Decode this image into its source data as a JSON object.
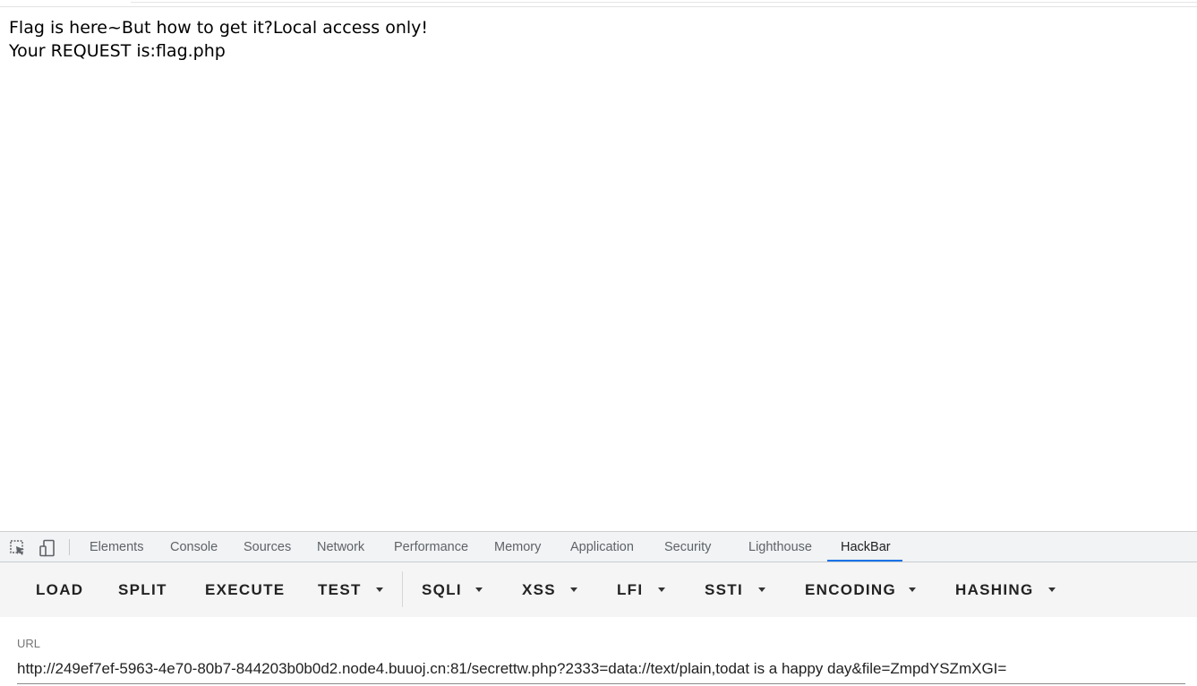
{
  "page": {
    "line1": "Flag is here~But how to get it?Local access only!",
    "line2": "Your REQUEST is:flag.php"
  },
  "devtools": {
    "icons": [
      "inspect-element-icon",
      "device-toolbar-icon"
    ],
    "tabs": [
      {
        "label": "Elements"
      },
      {
        "label": "Console"
      },
      {
        "label": "Sources"
      },
      {
        "label": "Network"
      },
      {
        "label": "Performance"
      },
      {
        "label": "Memory"
      },
      {
        "label": "Application"
      },
      {
        "label": "Security"
      },
      {
        "label": "Lighthouse"
      },
      {
        "label": "HackBar",
        "active": true
      }
    ],
    "accent_color": "#1a73e8"
  },
  "hackbar": {
    "buttons": [
      {
        "label": "LOAD"
      },
      {
        "label": "SPLIT"
      },
      {
        "label": "EXECUTE"
      },
      {
        "label": "TEST",
        "dropdown": true
      },
      {
        "label": "SQLI",
        "dropdown": true
      },
      {
        "label": "XSS",
        "dropdown": true
      },
      {
        "label": "LFI",
        "dropdown": true
      },
      {
        "label": "SSTI",
        "dropdown": true
      },
      {
        "label": "ENCODING",
        "dropdown": true
      },
      {
        "label": "HASHING",
        "dropdown": true
      }
    ],
    "url_label": "URL",
    "url_value": "http://249ef7ef-5963-4e70-80b7-844203b0b0d2.node4.buuoj.cn:81/secrettw.php?2333=data://text/plain,todat is a happy day&file=ZmpdYSZmXGI="
  }
}
